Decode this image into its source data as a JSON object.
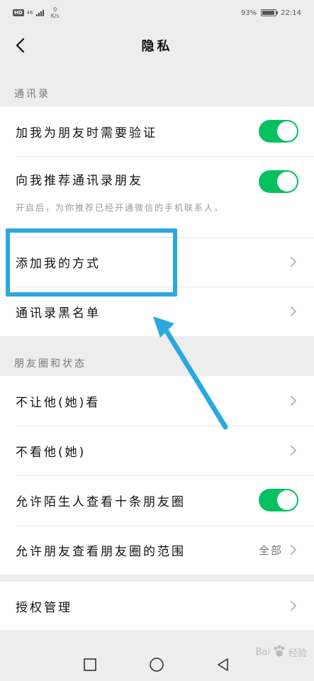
{
  "status_bar": {
    "hd": "HD",
    "network": "46",
    "speed_value": "0",
    "speed_unit": "K/s",
    "battery_percent": "93%",
    "battery_level": 0.93,
    "time": "22:14"
  },
  "nav": {
    "title": "隐私",
    "back_icon": "chevron-left-icon"
  },
  "contacts_section": {
    "header": "通讯录",
    "rows": [
      {
        "label": "加我为朋友时需要验证",
        "toggle_on": true
      },
      {
        "label": "向我推荐通讯录朋友",
        "toggle_on": true,
        "description": "开启后，为你推荐已经开通微信的手机联系人。"
      },
      {
        "label": "添加我的方式"
      },
      {
        "label": "通讯录黑名单"
      }
    ]
  },
  "moments_section": {
    "header": "朋友圈和状态",
    "rows": [
      {
        "label": "不让他(她)看"
      },
      {
        "label": "不看他(她)"
      },
      {
        "label": "允许陌生人查看十条朋友圈",
        "toggle_on": true
      },
      {
        "label": "允许朋友查看朋友圈的范围",
        "value": "全部"
      }
    ]
  },
  "auth_section": {
    "rows": [
      {
        "label": "授权管理"
      }
    ]
  },
  "watermark": {
    "text": "Bai",
    "text2": "经验"
  },
  "colors": {
    "toggle_on": "#07c160",
    "highlight": "#2aa8e0"
  }
}
